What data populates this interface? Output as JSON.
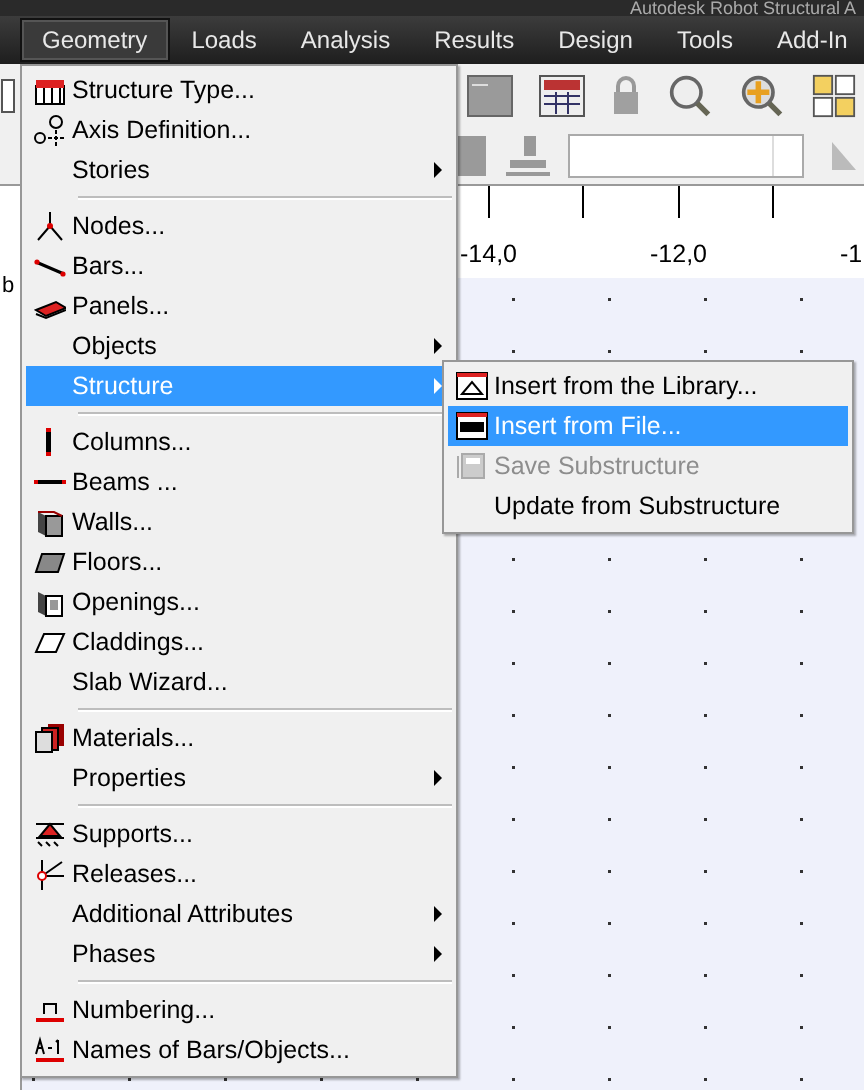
{
  "window": {
    "title": "Autodesk Robot Structural A"
  },
  "menubar": [
    {
      "label": "Geometry",
      "selected": true
    },
    {
      "label": "Loads",
      "selected": false
    },
    {
      "label": "Analysis",
      "selected": false
    },
    {
      "label": "Results",
      "selected": false
    },
    {
      "label": "Design",
      "selected": false
    },
    {
      "label": "Tools",
      "selected": false
    },
    {
      "label": "Add-In",
      "selected": false
    }
  ],
  "side_panel": {
    "label": "b"
  },
  "ruler": {
    "labels": [
      "-14,0",
      "-12,0",
      "-1"
    ]
  },
  "menu": [
    {
      "kind": "item",
      "label": "Structure Type...",
      "selected": false
    },
    {
      "kind": "item",
      "label": "Axis Definition...",
      "selected": false
    },
    {
      "kind": "item",
      "label": "Stories",
      "submenu": true,
      "selected": false
    },
    {
      "kind": "separator"
    },
    {
      "kind": "item",
      "label": "Nodes...",
      "selected": false
    },
    {
      "kind": "item",
      "label": "Bars...",
      "selected": false
    },
    {
      "kind": "item",
      "label": "Panels...",
      "selected": false
    },
    {
      "kind": "item",
      "label": "Objects",
      "submenu": true,
      "selected": false
    },
    {
      "kind": "item",
      "label": "Structure",
      "submenu": true,
      "selected": true
    },
    {
      "kind": "separator"
    },
    {
      "kind": "item",
      "label": "Columns...",
      "selected": false
    },
    {
      "kind": "item",
      "label": "Beams ...",
      "selected": false
    },
    {
      "kind": "item",
      "label": "Walls...",
      "selected": false
    },
    {
      "kind": "item",
      "label": "Floors...",
      "selected": false
    },
    {
      "kind": "item",
      "label": "Openings...",
      "selected": false
    },
    {
      "kind": "item",
      "label": "Claddings...",
      "selected": false
    },
    {
      "kind": "item",
      "label": "Slab Wizard...",
      "selected": false
    },
    {
      "kind": "separator"
    },
    {
      "kind": "item",
      "label": "Materials...",
      "selected": false
    },
    {
      "kind": "item",
      "label": "Properties",
      "submenu": true,
      "selected": false
    },
    {
      "kind": "separator"
    },
    {
      "kind": "item",
      "label": "Supports...",
      "selected": false
    },
    {
      "kind": "item",
      "label": "Releases...",
      "selected": false
    },
    {
      "kind": "item",
      "label": "Additional Attributes",
      "submenu": true,
      "selected": false
    },
    {
      "kind": "item",
      "label": "Phases",
      "submenu": true,
      "selected": false
    },
    {
      "kind": "separator"
    },
    {
      "kind": "item",
      "label": "Numbering...",
      "selected": false
    },
    {
      "kind": "item",
      "label": "Names of Bars/Objects...",
      "selected": false
    }
  ],
  "submenu": [
    {
      "label": "Insert from the Library...",
      "selected": false,
      "disabled": false
    },
    {
      "label": "Insert from File...",
      "selected": true,
      "disabled": false
    },
    {
      "label": "Save Substructure",
      "selected": false,
      "disabled": true
    },
    {
      "label": "Update from Substructure",
      "selected": false,
      "disabled": false
    }
  ]
}
